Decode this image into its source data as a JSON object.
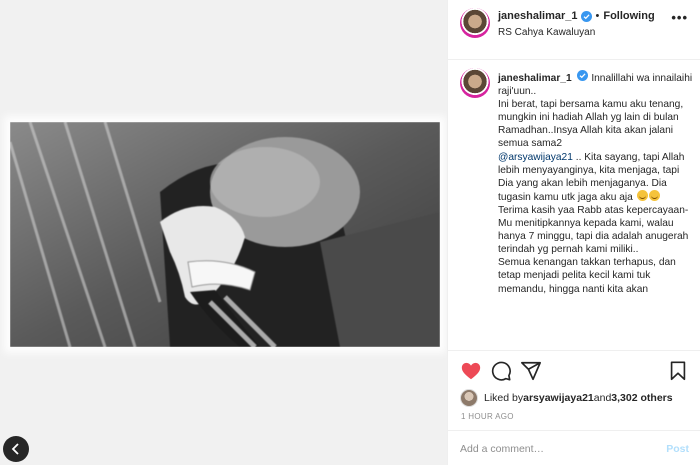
{
  "post": {
    "username": "janeshalimar_1",
    "separator": "•",
    "follow_status": "Following",
    "location": "RS Cahya Kawaluyan",
    "more_label": "•••"
  },
  "caption": {
    "username": "janeshalimar_1",
    "p1": "Innalillahi wa innailaihi raji'uun..",
    "p2": "Ini berat, tapi bersama kamu aku tenang, mungkin ini hadiah Allah yg lain di bulan Ramadhan..Insya Allah kita akan jalani semua sama2",
    "mention": "@arsyawijaya21",
    "p3": " .. Kita sayang, tapi Allah lebih menyayanginya, kita menjaga, tapi Dia yang akan lebih menjaganya. Dia tugasin kamu utk jaga aku aja",
    "p4": "Terima kasih yaa Rabb atas kepercayaan-Mu menitipkannya kepada kami, walau hanya 7 minggu, tapi dia adalah anugerah terindah yg pernah kami miliki..",
    "p5": "Semua kenangan takkan terhapus, dan tetap menjadi pelita kecil kami tuk memandu, hingga nanti kita akan"
  },
  "likes": {
    "prefix": "Liked by ",
    "user": "arsyawijaya21",
    "middle": " and ",
    "count": "3,302 others"
  },
  "timestamp": "1 HOUR AGO",
  "comment": {
    "placeholder": "Add a comment…",
    "post_label": "Post"
  },
  "icons": {
    "heart": "heart-icon",
    "comment": "comment-icon",
    "share": "share-icon",
    "save": "bookmark-icon",
    "verified": "verified-badge-icon",
    "prev": "chevron-left-icon"
  },
  "colors": {
    "heart": "#ed4956",
    "verified": "#3897f0",
    "mention": "#00376b",
    "post_button": "#b2dffc",
    "muted": "#8e8e8e"
  }
}
